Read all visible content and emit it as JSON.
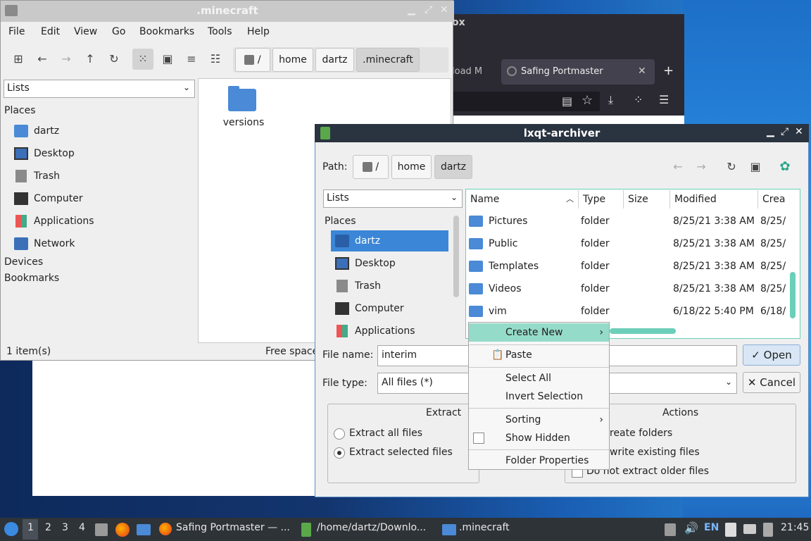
{
  "firefox": {
    "title_partial": "ox",
    "tab_partial": "load M",
    "tab_active": "Safing Portmaster",
    "tab_close": "✕",
    "new_tab": "+"
  },
  "filemanager": {
    "title": ".minecraft",
    "menus": [
      "File",
      "Edit",
      "View",
      "Go",
      "Bookmarks",
      "Tools",
      "Help"
    ],
    "breadcrumb": [
      "/",
      "home",
      "dartz",
      ".minecraft"
    ],
    "side_view": "Lists",
    "places_header": "Places",
    "places": [
      "dartz",
      "Desktop",
      "Trash",
      "Computer",
      "Applications",
      "Network"
    ],
    "devices_header": "Devices",
    "bookmarks_header": "Bookmarks",
    "files": [
      "versions"
    ],
    "status_count": "1 item(s)",
    "status_free": "Free space"
  },
  "archiver": {
    "title": "lxqt-archiver",
    "path_label": "Path:",
    "breadcrumb": [
      "/",
      "home",
      "dartz"
    ],
    "side_view": "Lists",
    "places_header": "Places",
    "places": [
      "dartz",
      "Desktop",
      "Trash",
      "Computer",
      "Applications"
    ],
    "columns": [
      "Name",
      "Type",
      "Size",
      "Modified",
      "Crea"
    ],
    "rows": [
      {
        "name": "Pictures",
        "type": "folder",
        "size": "",
        "modified": "8/25/21 3:38 AM",
        "created": "8/25/"
      },
      {
        "name": "Public",
        "type": "folder",
        "size": "",
        "modified": "8/25/21 3:38 AM",
        "created": "8/25/"
      },
      {
        "name": "Templates",
        "type": "folder",
        "size": "",
        "modified": "8/25/21 3:38 AM",
        "created": "8/25/"
      },
      {
        "name": "Videos",
        "type": "folder",
        "size": "",
        "modified": "8/25/21 3:38 AM",
        "created": "8/25/"
      },
      {
        "name": "vim",
        "type": "folder",
        "size": "",
        "modified": "6/18/22 5:40 PM",
        "created": "6/18/"
      }
    ],
    "filename_label": "File name:",
    "filename_value": "interim",
    "filetype_label": "File type:",
    "filetype_value": "All files (*)",
    "open_label": "Open",
    "cancel_label": "Cancel",
    "extract_group": "Extract",
    "extract_all": "Extract all files",
    "extract_selected": "Extract selected files",
    "actions_group": "Actions",
    "create_folders": "reate folders",
    "overwrite": "write existing files",
    "no_older": "Do not extract older files"
  },
  "context_menu": {
    "create_new": "Create New",
    "paste": "Paste",
    "select_all": "Select All",
    "invert_selection": "Invert Selection",
    "sorting": "Sorting",
    "show_hidden": "Show Hidden",
    "folder_properties": "Folder Properties"
  },
  "taskbar": {
    "desktops": [
      "1",
      "2",
      "3",
      "4"
    ],
    "tasks": [
      "Safing Portmaster — ...",
      "/home/dartz/Downlo...",
      ".minecraft"
    ],
    "lang": "EN",
    "clock": "21:45"
  },
  "colors": {
    "accent": "#4a8ad6",
    "selection": "#3b86d6",
    "menu_highlight": "#95dbc9"
  }
}
